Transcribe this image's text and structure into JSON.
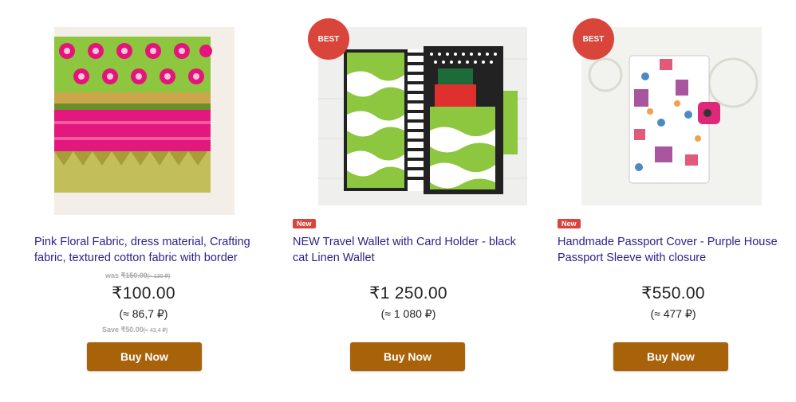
{
  "colors": {
    "title": "#2b1f8a",
    "badge": "#d9443b",
    "button": "#a8620a"
  },
  "products": [
    {
      "title": "Pink Floral Fabric, dress material, Crafting fabric, textured cotton fabric with border",
      "was_label": "was",
      "was_price": "₹150.00",
      "was_conv": "(≈ 130 ₽)",
      "price": "₹100.00",
      "conversion": "(≈ 86,7 ₽)",
      "save_label": "Save",
      "save_amount": "₹50.00",
      "save_conv": "(≈ 43,4 ₽)",
      "buy_label": "Buy Now",
      "image_icon": "fabric-photo"
    },
    {
      "badge_best": "BEST",
      "badge_new": "New",
      "title": "NEW Travel Wallet with Card Holder - black cat Linen Wallet",
      "price": "₹1 250.00",
      "conversion": "(≈ 1 080 ₽)",
      "buy_label": "Buy Now",
      "image_icon": "wallet-photo"
    },
    {
      "badge_best": "BEST",
      "badge_new": "New",
      "title": "Handmade Passport Cover - Purple House Passport Sleeve with closure",
      "price": "₹550.00",
      "conversion": "(≈ 477 ₽)",
      "buy_label": "Buy Now",
      "image_icon": "passport-cover-photo"
    }
  ]
}
